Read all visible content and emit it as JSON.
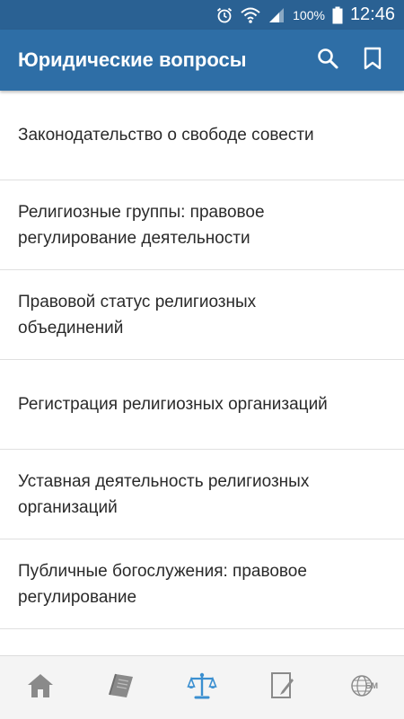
{
  "status_bar": {
    "battery_percent": "100%",
    "time": "12:46",
    "icons": [
      "alarm-icon",
      "wifi-icon",
      "signal-icon",
      "battery-icon"
    ]
  },
  "app_bar": {
    "title": "Юридические вопросы",
    "actions": [
      "search-icon",
      "bookmark-icon"
    ]
  },
  "list": {
    "items": [
      {
        "label": "Законодательство о свободе совести"
      },
      {
        "label": "Религиозные группы: правовое регулирование деятельности"
      },
      {
        "label": "Правовой статус религиозных объединений"
      },
      {
        "label": "Регистрация религиозных организаций"
      },
      {
        "label": "Уставная деятельность религиозных организаций"
      },
      {
        "label": "Публичные богослужения: правовое регулирование"
      }
    ]
  },
  "bottom_nav": {
    "items": [
      {
        "icon": "home-icon"
      },
      {
        "icon": "book-icon"
      },
      {
        "icon": "scales-icon",
        "active": true
      },
      {
        "icon": "document-edit-icon"
      },
      {
        "icon": "globe-logo-icon",
        "logo_text": "БМ"
      }
    ]
  },
  "colors": {
    "status_bar": "#2a6193",
    "app_bar": "#2e6ea6",
    "active_nav": "#3b8fd0",
    "inactive_nav": "#8a8a8a"
  }
}
